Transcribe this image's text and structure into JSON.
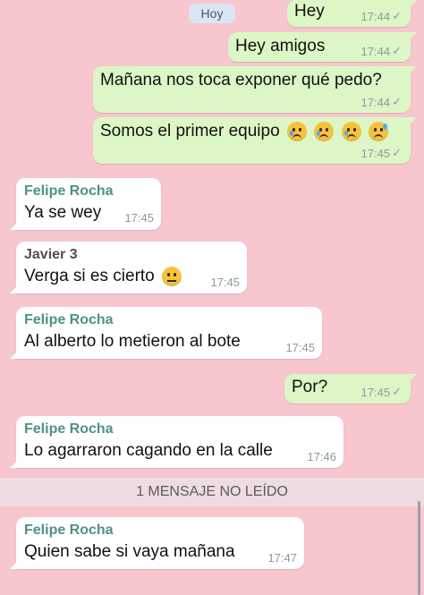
{
  "date_chip": "Hoy",
  "unread_divider": "1 MENSAJE NO LEÍDO",
  "colors": {
    "background": "#f7c6cf",
    "outgoing": "#dcf7c5",
    "incoming": "#ffffff",
    "felipe": "#4f9187",
    "javier": "#5a4b4d"
  },
  "messages": [
    {
      "sender": "",
      "text": "Hey",
      "time": "17:44",
      "status": "✓"
    },
    {
      "sender": "",
      "text": "Hey amigos",
      "time": "17:44",
      "status": "✓"
    },
    {
      "sender": "",
      "text": "Mañana nos toca exponer qué pedo?",
      "time": "17:44",
      "status": "✓"
    },
    {
      "sender": "",
      "text": "Somos el primer equipo",
      "time": "17:45",
      "status": "✓",
      "emoji": [
        "crying-face",
        "crying-face",
        "crying-face",
        "downcast-sweat-face"
      ]
    },
    {
      "sender": "Felipe Rocha",
      "text": "Ya se wey",
      "time": "17:45"
    },
    {
      "sender": "Javier 3",
      "text": "Verga si es cierto",
      "time": "17:45",
      "emoji": [
        "neutral-face"
      ]
    },
    {
      "sender": "Felipe Rocha",
      "text": "Al alberto lo metieron al bote",
      "time": "17:45"
    },
    {
      "sender": "",
      "text": "Por?",
      "time": "17:45",
      "status": "✓"
    },
    {
      "sender": "Felipe Rocha",
      "text": "Lo agarraron cagando en la calle",
      "time": "17:46"
    },
    {
      "sender": "Felipe Rocha",
      "text": "Quien sabe si vaya mañana",
      "time": "17:47"
    }
  ]
}
